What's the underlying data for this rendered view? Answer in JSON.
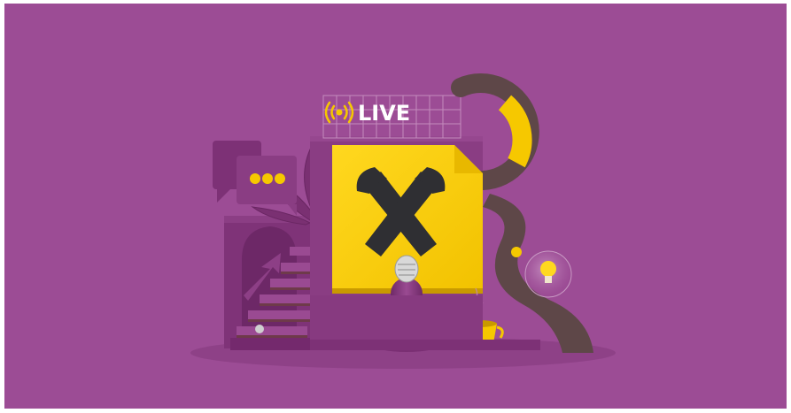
{
  "scene": {
    "live_label": "LIVE",
    "colors": {
      "background": "#9c4c95",
      "floor": "#8f4288",
      "purple_dark": "#7b3074",
      "purple_mid": "#8a3d83",
      "yellow": "#f6c800",
      "yellow_light": "#ffd91f",
      "logo_dark": "#2f2f33",
      "brown": "#5e4748",
      "chrome": "#cfcfcf"
    },
    "icons": [
      "broadcast-icon",
      "chat-bubble-icon",
      "brand-logo-icon",
      "microphone-icon",
      "coffee-cup-icon",
      "lightbulb-icon"
    ]
  }
}
